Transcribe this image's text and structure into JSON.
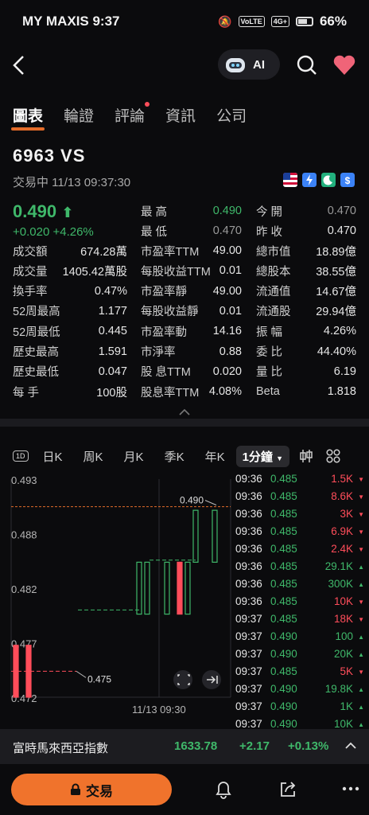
{
  "statusbar": {
    "carrier_time": "MY MAXIS 9:37",
    "net_badge": "VoLTE",
    "signal_badge": "4G+",
    "battery": "66%"
  },
  "nav": {
    "ai_label": "AI"
  },
  "tabs": [
    {
      "label": "圖表",
      "active": true
    },
    {
      "label": "輪證"
    },
    {
      "label": "評論",
      "dot": true
    },
    {
      "label": "資訊"
    },
    {
      "label": "公司"
    }
  ],
  "stock": {
    "code": "6963  VS",
    "status": "交易中  11/13 09:37:30",
    "price": "0.490",
    "change": "+0.020  +4.26%",
    "high_label": "最  高",
    "high": "0.490",
    "low_label": "最  低",
    "low": "0.470",
    "open_label": "今  開",
    "open": "0.470",
    "prev_label": "昨  收",
    "prev": "0.470"
  },
  "stats": [
    [
      "成交額",
      "674.28萬",
      "市盈率TTM",
      "49.00",
      "總市值",
      "18.89億"
    ],
    [
      "成交量",
      "1405.42萬股",
      "每股收益TTM",
      "0.01",
      "總股本",
      "38.55億"
    ],
    [
      "換手率",
      "0.47%",
      "市盈率靜",
      "49.00",
      "流通值",
      "14.67億"
    ],
    [
      "52周最高",
      "1.177",
      "每股收益靜",
      "0.01",
      "流通股",
      "29.94億"
    ],
    [
      "52周最低",
      "0.445",
      "市盈率動",
      "14.16",
      "振  幅",
      "4.26%"
    ],
    [
      "歷史最高",
      "1.591",
      "市淨率",
      "0.88",
      "委  比",
      "44.40%"
    ],
    [
      "歷史最低",
      "0.047",
      "股  息TTM",
      "0.020",
      "量  比",
      "6.19"
    ],
    [
      "每  手",
      "100股",
      "股息率TTM",
      "4.08%",
      "Beta",
      "1.818"
    ]
  ],
  "chart_tabs": [
    "日K",
    "周K",
    "月K",
    "季K",
    "年K",
    "1分鐘"
  ],
  "chart": {
    "y_ticks": [
      "0.493",
      "0.488",
      "0.482",
      "0.477",
      "0.472"
    ],
    "price_marker": "0.490",
    "low_marker": "0.475",
    "x_label": "11/13 09:30"
  },
  "chart_data": {
    "type": "candlestick",
    "x_label": "11/13 09:30",
    "ylim": [
      0.472,
      0.493
    ],
    "candles": [
      {
        "o": 0.477,
        "h": 0.477,
        "l": 0.472,
        "c": 0.472,
        "color": "red"
      },
      {
        "o": 0.477,
        "h": 0.477,
        "l": 0.472,
        "c": 0.472,
        "color": "red"
      },
      {
        "o": 0.48,
        "h": 0.485,
        "l": 0.48,
        "c": 0.485,
        "color": "green"
      },
      {
        "o": 0.48,
        "h": 0.485,
        "l": 0.48,
        "c": 0.485,
        "color": "green"
      },
      {
        "o": 0.48,
        "h": 0.485,
        "l": 0.48,
        "c": 0.485,
        "color": "green"
      },
      {
        "o": 0.485,
        "h": 0.485,
        "l": 0.48,
        "c": 0.48,
        "color": "red"
      },
      {
        "o": 0.48,
        "h": 0.485,
        "l": 0.48,
        "c": 0.485,
        "color": "green"
      },
      {
        "o": 0.485,
        "h": 0.49,
        "l": 0.485,
        "c": 0.49,
        "color": "green"
      },
      {
        "o": 0.485,
        "h": 0.49,
        "l": 0.485,
        "c": 0.49,
        "color": "green"
      }
    ]
  },
  "trades": [
    [
      "09:36",
      "0.485",
      "1.5K",
      "down"
    ],
    [
      "09:36",
      "0.485",
      "8.6K",
      "down"
    ],
    [
      "09:36",
      "0.485",
      "3K",
      "down"
    ],
    [
      "09:36",
      "0.485",
      "6.9K",
      "down"
    ],
    [
      "09:36",
      "0.485",
      "2.4K",
      "down"
    ],
    [
      "09:36",
      "0.485",
      "29.1K",
      "up"
    ],
    [
      "09:36",
      "0.485",
      "300K",
      "up"
    ],
    [
      "09:36",
      "0.485",
      "10K",
      "down"
    ],
    [
      "09:37",
      "0.485",
      "18K",
      "down"
    ],
    [
      "09:37",
      "0.490",
      "100",
      "up"
    ],
    [
      "09:37",
      "0.490",
      "20K",
      "up"
    ],
    [
      "09:37",
      "0.485",
      "5K",
      "down"
    ],
    [
      "09:37",
      "0.490",
      "19.8K",
      "up"
    ],
    [
      "09:37",
      "0.490",
      "1K",
      "up"
    ],
    [
      "09:37",
      "0.490",
      "10K",
      "up"
    ]
  ],
  "ticker": {
    "name": "富時馬來西亞指數",
    "value": "1633.78",
    "change": "+2.17",
    "pct": "+0.13%"
  },
  "bottom": {
    "trade_label": "交易"
  },
  "colors": {
    "accent": "#f0732c",
    "up": "#3fb86a",
    "down": "#ff4d5a"
  }
}
